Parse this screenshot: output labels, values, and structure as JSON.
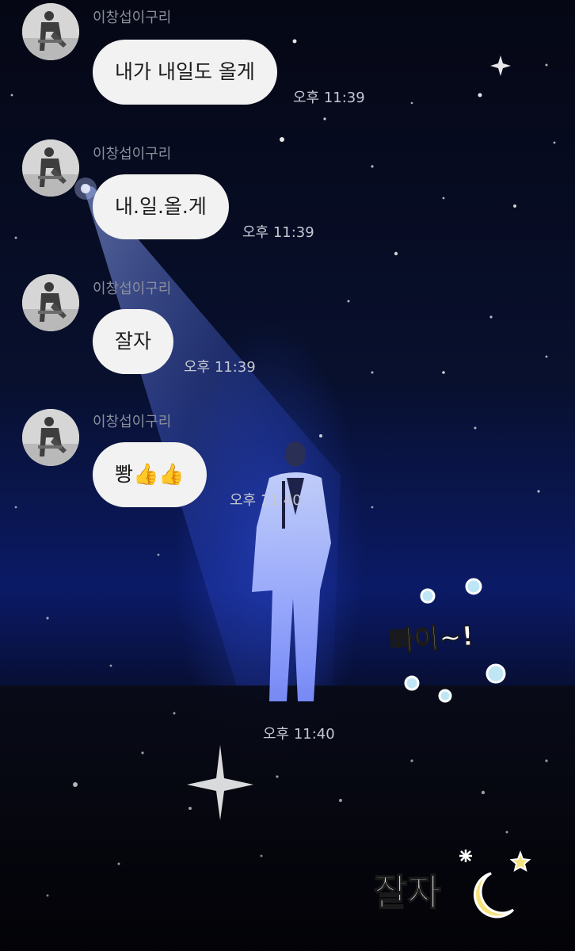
{
  "chat": {
    "sender_name": "이창섭이구리",
    "messages": [
      {
        "text": "내가 내일도 올게",
        "time": "오후 11:39"
      },
      {
        "text": "내.일.올.게",
        "time": "오후 11:39"
      },
      {
        "text": "잘자",
        "time": "오후 11:39"
      },
      {
        "text_prefix": "뽱",
        "emoji": "👍👍",
        "time": "오후 11:40"
      }
    ],
    "last_time": "오후 11:40"
  },
  "stickers": {
    "bye": "빠이~!",
    "goodnight": "잘자"
  },
  "colors": {
    "bubble": "#f2f2f2",
    "time_text": "#c5c8d2",
    "sender_text": "#8a8f9c",
    "sticker_bubble": "#bfe6f5"
  },
  "icons": {
    "avatar": "profile-photo",
    "thumbs_up": "thumbs-up-emoji",
    "moon": "crescent-moon",
    "star": "star"
  }
}
